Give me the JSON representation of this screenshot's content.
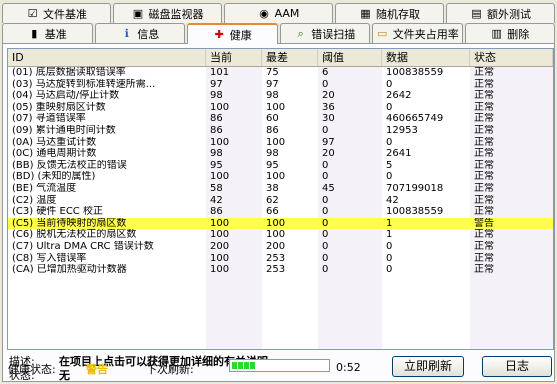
{
  "tabs_row1": [
    {
      "label": "文件基准",
      "icon": "document-icon",
      "glyph": "☑"
    },
    {
      "label": "磁盘监视器",
      "icon": "monitor-icon",
      "glyph": "▣"
    },
    {
      "label": "AAM",
      "icon": "speaker-icon",
      "glyph": "◉"
    },
    {
      "label": "随机存取",
      "icon": "grid-icon",
      "glyph": "▦"
    },
    {
      "label": "额外测试",
      "icon": "list-icon",
      "glyph": "▤"
    }
  ],
  "tabs_row2": [
    {
      "label": "基准",
      "icon": "chart-icon",
      "glyph": "▮"
    },
    {
      "label": "信息",
      "icon": "info-icon",
      "glyph": "ℹ"
    },
    {
      "label": "健康",
      "icon": "health-icon",
      "glyph": "✚"
    },
    {
      "label": "错误扫描",
      "icon": "scan-icon",
      "glyph": "⌕"
    },
    {
      "label": "文件夹占用率",
      "icon": "folder-icon",
      "glyph": "▭"
    },
    {
      "label": "删除",
      "icon": "delete-icon",
      "glyph": "▥"
    }
  ],
  "table": {
    "headers": [
      "ID",
      "当前",
      "最差",
      "阈值",
      "数据",
      "状态"
    ],
    "rows": [
      {
        "id": "(01) 底层数据读取错误率",
        "cur": "101",
        "worst": "75",
        "thr": "6",
        "data": "100838559",
        "status": "正常"
      },
      {
        "id": "(03) 马达旋转到标准转速所需...",
        "cur": "97",
        "worst": "97",
        "thr": "0",
        "data": "0",
        "status": "正常"
      },
      {
        "id": "(04) 马达启动/停止计数",
        "cur": "98",
        "worst": "98",
        "thr": "20",
        "data": "2642",
        "status": "正常"
      },
      {
        "id": "(05) 重映射扇区计数",
        "cur": "100",
        "worst": "100",
        "thr": "36",
        "data": "0",
        "status": "正常"
      },
      {
        "id": "(07) 寻道错误率",
        "cur": "86",
        "worst": "60",
        "thr": "30",
        "data": "460665749",
        "status": "正常"
      },
      {
        "id": "(09) 累计通电时间计数",
        "cur": "86",
        "worst": "86",
        "thr": "0",
        "data": "12953",
        "status": "正常"
      },
      {
        "id": "(0A) 马达重试计数",
        "cur": "100",
        "worst": "100",
        "thr": "97",
        "data": "0",
        "status": "正常"
      },
      {
        "id": "(0C) 通电周期计数",
        "cur": "98",
        "worst": "98",
        "thr": "20",
        "data": "2641",
        "status": "正常"
      },
      {
        "id": "(BB) 反馈无法校正的错误",
        "cur": "95",
        "worst": "95",
        "thr": "0",
        "data": "5",
        "status": "正常"
      },
      {
        "id": "(BD) (未知的属性)",
        "cur": "100",
        "worst": "100",
        "thr": "0",
        "data": "0",
        "status": "正常"
      },
      {
        "id": "(BE) 气流温度",
        "cur": "58",
        "worst": "38",
        "thr": "45",
        "data": "707199018",
        "status": "正常"
      },
      {
        "id": "(C2) 温度",
        "cur": "42",
        "worst": "62",
        "thr": "0",
        "data": "42",
        "status": "正常"
      },
      {
        "id": "(C3) 硬件 ECC 校正",
        "cur": "86",
        "worst": "66",
        "thr": "0",
        "data": "100838559",
        "status": "正常"
      },
      {
        "id": "(C5) 当前待映射的扇区数",
        "cur": "100",
        "worst": "100",
        "thr": "0",
        "data": "1",
        "status": "警告",
        "highlight": true
      },
      {
        "id": "(C6) 脱机无法校正的扇区数",
        "cur": "100",
        "worst": "100",
        "thr": "0",
        "data": "1",
        "status": "正常"
      },
      {
        "id": "(C7) Ultra DMA CRC 错误计数",
        "cur": "200",
        "worst": "200",
        "thr": "0",
        "data": "0",
        "status": "正常"
      },
      {
        "id": "(C8) 写入错误率",
        "cur": "100",
        "worst": "253",
        "thr": "0",
        "data": "0",
        "status": "正常"
      },
      {
        "id": "(CA) 已增加热驱动计数器",
        "cur": "100",
        "worst": "253",
        "thr": "0",
        "data": "0",
        "status": "正常"
      }
    ]
  },
  "description": {
    "label": "描述:",
    "value": "在项目上点击可以获得更加详细的有关说明"
  },
  "state": {
    "label": "状态:",
    "value": "无"
  },
  "footer": {
    "health_label": "健康状态:",
    "health_value": "警告",
    "health_color": "#e8c000",
    "next_refresh_label": "下次刷新:",
    "progress_fraction": 0.25,
    "countdown": "0:52",
    "refresh_button": "立即刷新",
    "log_button": "日志"
  }
}
